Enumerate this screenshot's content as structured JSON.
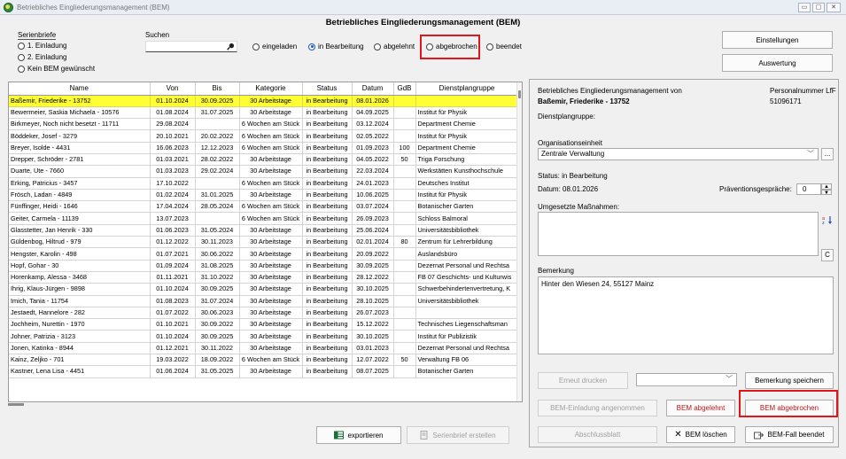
{
  "window": {
    "title": "Betriebliches Eingliederungsmanagement (BEM)",
    "minimize": "▭",
    "maximize": "▢",
    "close": "✕"
  },
  "heading": "Betriebliches Eingliederungsmanagement (BEM)",
  "serienbriefe": {
    "label": "Serienbriefe",
    "options": [
      "1. Einladung",
      "2. Einladung",
      "Kein BEM gewünscht"
    ]
  },
  "search": {
    "label": "Suchen",
    "value": ""
  },
  "status_filter": {
    "options": [
      "eingeladen",
      "in Bearbeitung",
      "abgelehnt",
      "abgebrochen",
      "beendet"
    ],
    "selected": "in Bearbeitung"
  },
  "top_buttons": {
    "settings": "Einstellungen",
    "evaluation": "Auswertung"
  },
  "table": {
    "columns": [
      "Name",
      "Von",
      "Bis",
      "Kategorie",
      "Status",
      "Datum",
      "GdB",
      "Dienstplangruppe"
    ],
    "rows": [
      [
        "Baßemir, Friederike - 13752",
        "01.10.2024",
        "30.09.2025",
        "30 Arbeitstage",
        "in Bearbeitung",
        "08.01.2026",
        "",
        ""
      ],
      [
        "Bewermeier, Saskia Michaela - 10576",
        "01.08.2024",
        "31.07.2025",
        "30 Arbeitstage",
        "in Bearbeitung",
        "04.09.2025",
        "",
        "Institut für Physik"
      ],
      [
        "Birkmeyer, Noch nicht besetzt - 11711",
        "29.08.2024",
        "",
        "6 Wochen am Stück",
        "in Bearbeitung",
        "03.12.2024",
        "",
        "Department Chemie"
      ],
      [
        "Böddeker, Josef - 3279",
        "20.10.2021",
        "20.02.2022",
        "6 Wochen am Stück",
        "in Bearbeitung",
        "02.05.2022",
        "",
        "Institut für Physik"
      ],
      [
        "Breyer, Isolde - 4431",
        "16.06.2023",
        "12.12.2023",
        "6 Wochen am Stück",
        "in Bearbeitung",
        "01.09.2023",
        "100",
        "Department Chemie"
      ],
      [
        "Drepper, Schröder - 2781",
        "01.03.2021",
        "28.02.2022",
        "30 Arbeitstage",
        "in Bearbeitung",
        "04.05.2022",
        "50",
        "Triga Forschung"
      ],
      [
        "Duarte, Ute - 7660",
        "01.03.2023",
        "29.02.2024",
        "30 Arbeitstage",
        "in Bearbeitung",
        "22.03.2024",
        "",
        "Werkstätten Kunsthochschule"
      ],
      [
        "Erking, Patricius - 3457",
        "17.10.2022",
        "",
        "6 Wochen am Stück",
        "in Bearbeitung",
        "24.01.2023",
        "",
        "Deutsches Institut"
      ],
      [
        "Frösch, Ladan - 4849",
        "01.02.2024",
        "31.01.2025",
        "30 Arbeitstage",
        "in Bearbeitung",
        "10.06.2025",
        "",
        "Institut für Physik"
      ],
      [
        "Fünffinger, Heidi - 1646",
        "17.04.2024",
        "28.05.2024",
        "6 Wochen am Stück",
        "in Bearbeitung",
        "03.07.2024",
        "",
        "Botanischer Garten"
      ],
      [
        "Geiter, Carmela - 11139",
        "13.07.2023",
        "",
        "6 Wochen am Stück",
        "in Bearbeitung",
        "26.09.2023",
        "",
        "Schloss Balmoral"
      ],
      [
        "Glasstetter, Jan Henrik - 330",
        "01.06.2023",
        "31.05.2024",
        "30 Arbeitstage",
        "in Bearbeitung",
        "25.06.2024",
        "",
        "Universitätsbibliothek"
      ],
      [
        "Güldenbog, Hiltrud - 979",
        "01.12.2022",
        "30.11.2023",
        "30 Arbeitstage",
        "in Bearbeitung",
        "02.01.2024",
        "80",
        "Zentrum für Lehrerbildung"
      ],
      [
        "Hengster, Karolin - 498",
        "01.07.2021",
        "30.06.2022",
        "30 Arbeitstage",
        "in Bearbeitung",
        "20.09.2022",
        "",
        "Auslandsbüro"
      ],
      [
        "Hopf, Gohar - 30",
        "01.09.2024",
        "31.08.2025",
        "30 Arbeitstage",
        "in Bearbeitung",
        "30.09.2025",
        "",
        "Dezernat Personal und Rechtsa"
      ],
      [
        "Horenkamp, Alessa - 3468",
        "01.11.2021",
        "31.10.2022",
        "30 Arbeitstage",
        "in Bearbeitung",
        "28.12.2022",
        "",
        "FB 07 Geschichts- und Kulturwis"
      ],
      [
        "Ihrig, Klaus-Jürgen - 9898",
        "01.10.2024",
        "30.09.2025",
        "30 Arbeitstage",
        "in Bearbeitung",
        "30.10.2025",
        "",
        "Schwerbehindertenvertretung, K"
      ],
      [
        "Imich, Tania - 11754",
        "01.08.2023",
        "31.07.2024",
        "30 Arbeitstage",
        "in Bearbeitung",
        "28.10.2025",
        "",
        "Universitätsbibliothek"
      ],
      [
        "Jestaedt, Hannelore - 282",
        "01.07.2022",
        "30.06.2023",
        "30 Arbeitstage",
        "in Bearbeitung",
        "26.07.2023",
        "",
        ""
      ],
      [
        "Jochheim, Nurettin - 1970",
        "01.10.2021",
        "30.09.2022",
        "30 Arbeitstage",
        "in Bearbeitung",
        "15.12.2022",
        "",
        "Technisches Liegenschaftsman"
      ],
      [
        "Johner, Patrizia - 3123",
        "01.10.2024",
        "30.09.2025",
        "30 Arbeitstage",
        "in Bearbeitung",
        "30.10.2025",
        "",
        "Institut für Publizistik"
      ],
      [
        "Jonen, Katinka - 8944",
        "01.12.2021",
        "30.11.2022",
        "30 Arbeitstage",
        "in Bearbeitung",
        "03.01.2023",
        "",
        "Dezernat Personal und Rechtsa"
      ],
      [
        "Kainz, Zeljko - 701",
        "19.03.2022",
        "18.09.2022",
        "6 Wochen am Stück",
        "in Bearbeitung",
        "12.07.2022",
        "50",
        "Verwaltung FB 06"
      ],
      [
        "Kastner, Lena Lisa - 4451",
        "01.06.2024",
        "31.05.2025",
        "30 Arbeitstage",
        "in Bearbeitung",
        "08.07.2025",
        "",
        "Botanischer Garten"
      ]
    ]
  },
  "bottom_buttons": {
    "export": "exportieren",
    "serienbrief": "Serienbrief erstellen"
  },
  "detail": {
    "header": "Betriebliches Eingliederungsmanagement von",
    "personnel_label": "Personalnummer LfF",
    "name": "Baßemir, Friederike - 13752",
    "personnel_number": "51096171",
    "dienstplangruppe_label": "Dienstplangruppe:",
    "org_label": "Organisationseinheit",
    "org_value": "Zentrale Verwaltung",
    "org_more": "...",
    "status_text": "Status: in Bearbeitung",
    "date_text": "Datum: 08.01.2026",
    "praevention_label": "Präventionsgespräche:",
    "praevention_value": "0",
    "measures_label": "Umgesetzte Maßnahmen:",
    "clear_btn": "C",
    "remark_label": "Bemerkung",
    "remark_value": "Hinter den Wiesen 24, 55127 Mainz",
    "buttons": {
      "reprint": "Erneut drucken",
      "save_remark": "Bemerkung speichern",
      "accepted": "BEM-Einladung angenommen",
      "rejected": "BEM abgelehnt",
      "aborted": "BEM abgebrochen",
      "final_sheet": "Abschlussblatt",
      "delete": "BEM löschen",
      "finish": "BEM-Fall beendet"
    }
  }
}
